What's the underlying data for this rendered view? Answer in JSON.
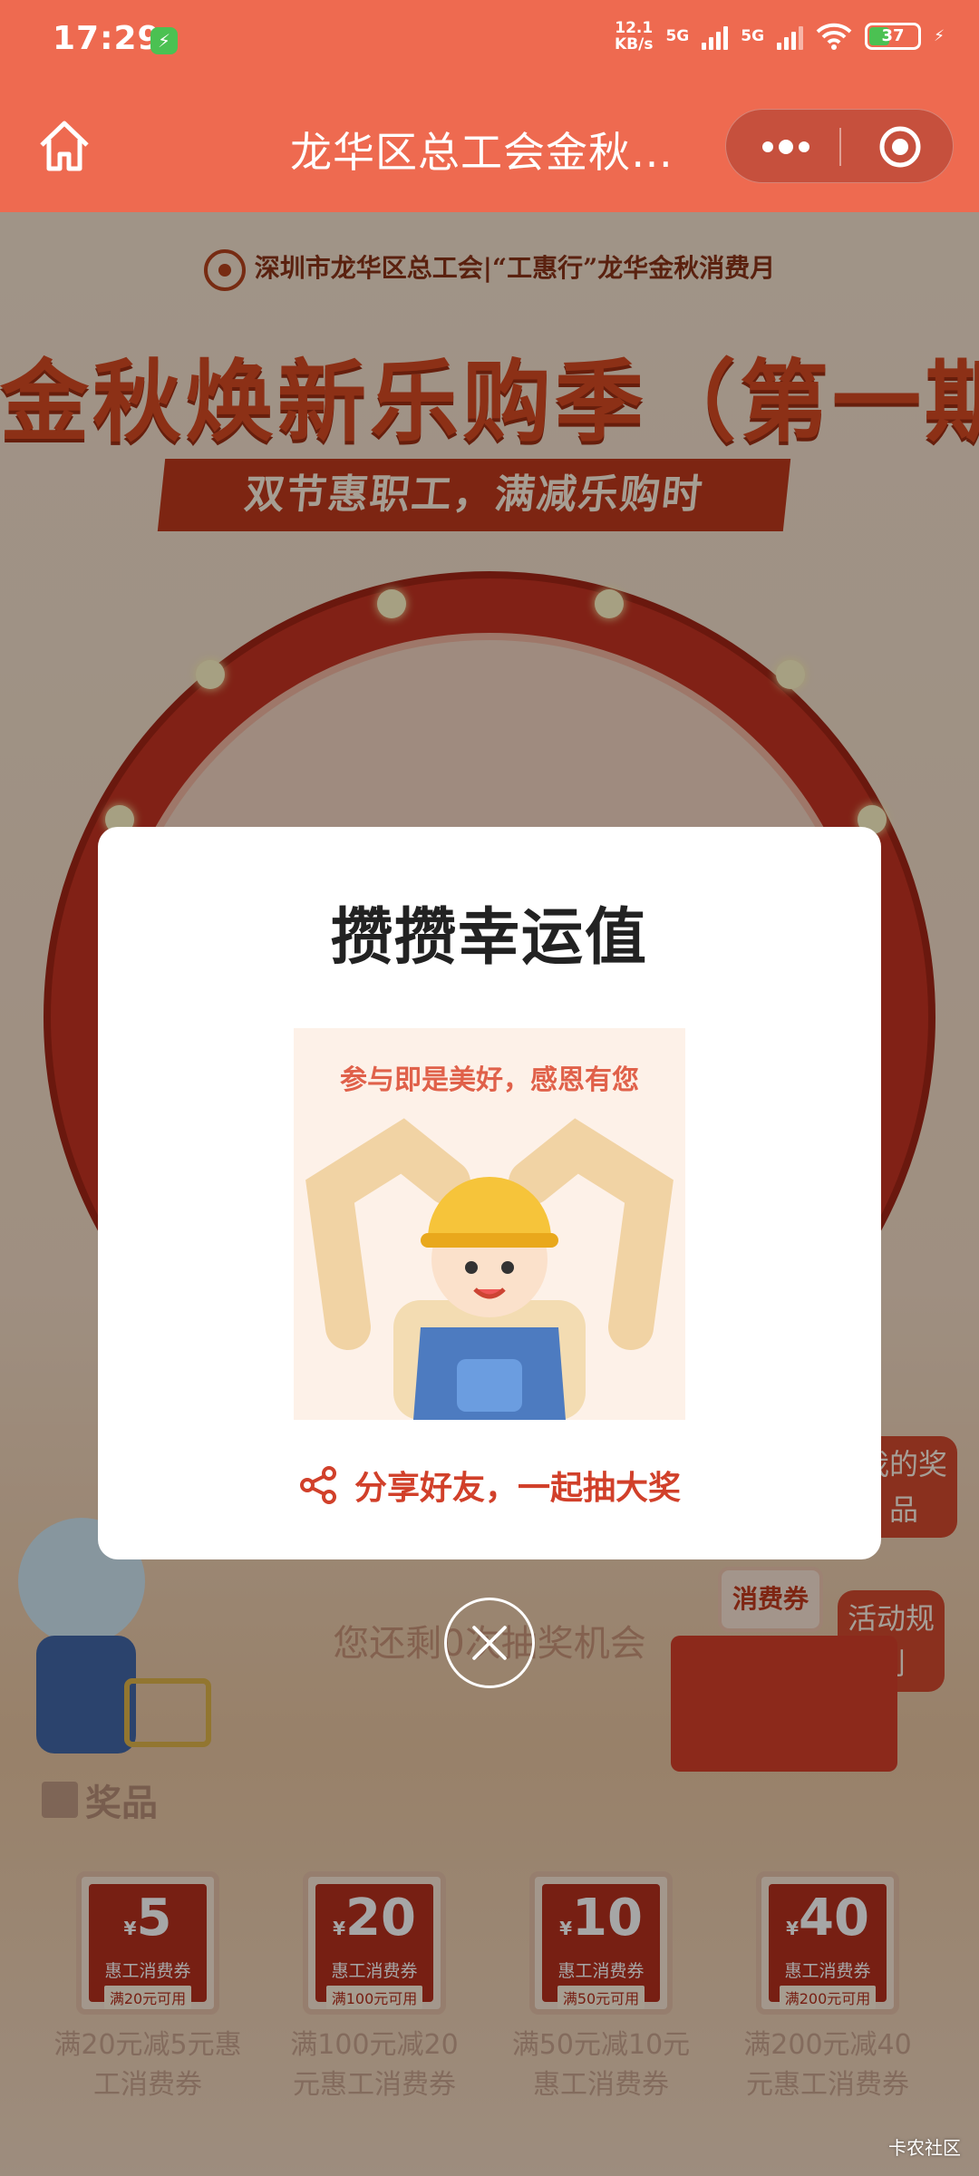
{
  "status_bar": {
    "time": "17:29",
    "net_speed_value": "12.1",
    "net_speed_unit": "KB/s",
    "sig1": "5G",
    "sig2": "5G",
    "battery": "37"
  },
  "navbar": {
    "title": "龙华区总工会金秋…",
    "home_icon": "home-icon",
    "more_icon": "more-icon",
    "target_icon": "target-icon"
  },
  "background": {
    "org_line": "深圳市龙华区总工会|“工惠行”龙华金秋消费月",
    "big_title": "金秋焕新乐购季（第一期）",
    "ribbon": "双节惠职工，满减乐购时",
    "side_buttons": [
      "我的奖品",
      "活动规则"
    ],
    "coupon_tag": "消费券",
    "draw_chances": "您还剩0次抽奖机会",
    "prize_header": "奖品",
    "prizes": [
      {
        "amount": "5",
        "currency": "¥",
        "ticket_label": "惠工消费券",
        "ticket_cond": "满20元可用",
        "desc": "满20元减5元惠工消费券"
      },
      {
        "amount": "20",
        "currency": "¥",
        "ticket_label": "惠工消费券",
        "ticket_cond": "满100元可用",
        "desc": "满100元减20元惠工消费券"
      },
      {
        "amount": "10",
        "currency": "¥",
        "ticket_label": "惠工消费券",
        "ticket_cond": "满50元可用",
        "desc": "满50元减10元惠工消费券"
      },
      {
        "amount": "40",
        "currency": "¥",
        "ticket_label": "惠工消费券",
        "ticket_cond": "满200元可用",
        "desc": "满200元减40元惠工消费券"
      }
    ]
  },
  "modal": {
    "title": "攒攒幸运值",
    "image_caption": "参与即是美好，感恩有您",
    "share_text": "分享好友，一起抽大奖",
    "share_icon": "share-icon",
    "close_icon": "close-icon"
  },
  "watermark": "卡农社区",
  "colors": {
    "brand": "#ee6a50",
    "accent_red": "#d1402a",
    "modal_bg": "#ffffff"
  }
}
